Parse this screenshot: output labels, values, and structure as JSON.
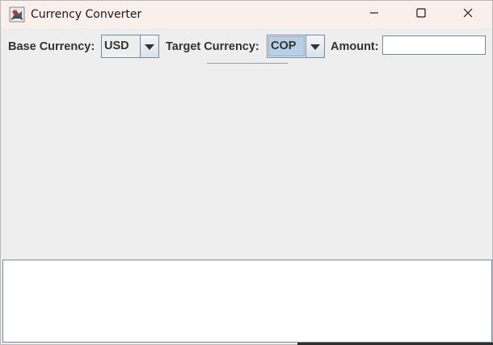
{
  "window": {
    "title": "Currency Converter",
    "icon": "java-app-icon",
    "controls": {
      "minimize_icon": "minimize-icon",
      "maximize_icon": "maximize-icon",
      "close_icon": "close-icon"
    }
  },
  "form": {
    "base_label": "Base Currency:",
    "base_value": "USD",
    "target_label": "Target Currency:",
    "target_value": "COP",
    "amount_label": "Amount:",
    "amount_value": ""
  },
  "result": {
    "text": ""
  },
  "colors": {
    "titlebar": "#f9efeb",
    "panel": "#eeeeee",
    "selection": "#b8cfe5",
    "border": "#7a8a99"
  }
}
